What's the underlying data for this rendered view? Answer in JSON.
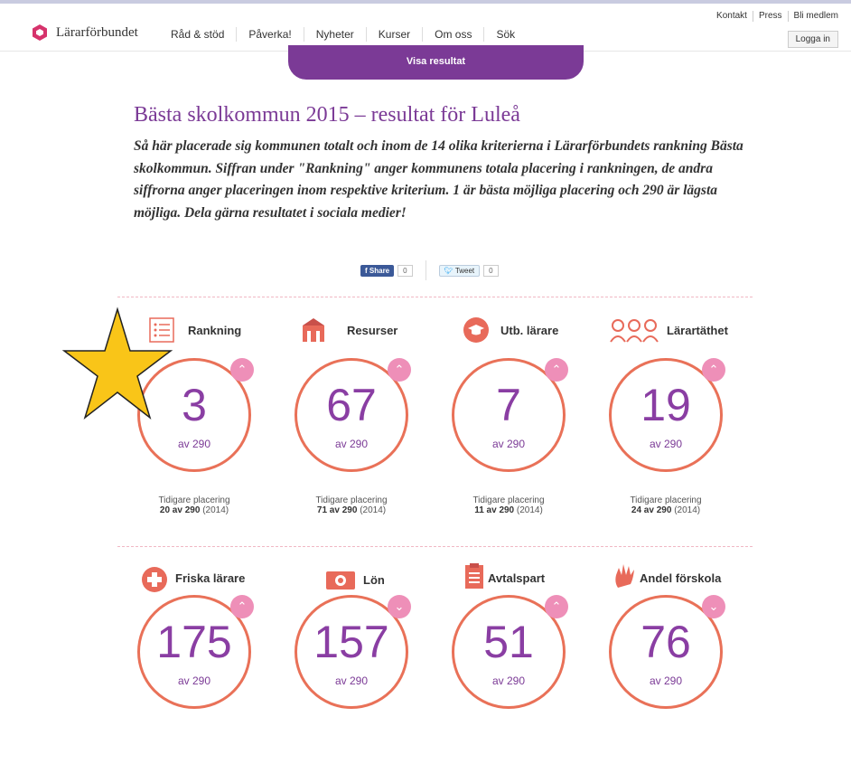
{
  "header": {
    "logo_text": "Lärarförbundet",
    "nav": [
      "Råd & stöd",
      "Påverka!",
      "Nyheter",
      "Kurser",
      "Om oss",
      "Sök"
    ],
    "util": [
      "Kontakt",
      "Press",
      "Bli medlem"
    ],
    "login": "Logga in"
  },
  "visa_resultat": "Visa resultat",
  "title": "Bästa skolkommun 2015 – resultat för Luleå",
  "intro": "Så här placerade sig kommunen totalt och inom de 14 olika kriterierna i Lärarförbundets rankning Bästa skolkommun. Siffran under \"Rankning\" anger kommunens totala placering i rankningen, de andra siffrorna anger placeringen inom respektive kriterium. 1 är bästa möjliga placering och 290 är lägsta möjliga. Dela gärna resultatet i sociala medier!",
  "social": {
    "share": "Share",
    "share_count": "0",
    "tweet": "Tweet",
    "tweet_count": "0"
  },
  "colors": {
    "purple": "#7b3a96",
    "ring": "#e97158",
    "trend": "#ee8fb8"
  },
  "criteria": [
    {
      "label": "Rankning",
      "icon": "list-icon",
      "number": "3",
      "sub": "av 290",
      "trend": "up",
      "prev_label": "Tidigare placering",
      "prev_value": "20 av 290",
      "prev_year": "(2014)"
    },
    {
      "label": "Resurser",
      "icon": "building-icon",
      "number": "67",
      "sub": "av 290",
      "trend": "up",
      "prev_label": "Tidigare placering",
      "prev_value": "71 av 290",
      "prev_year": "(2014)"
    },
    {
      "label": "Utb. lärare",
      "icon": "graduation-cap-icon",
      "number": "7",
      "sub": "av 290",
      "trend": "up",
      "prev_label": "Tidigare placering",
      "prev_value": "11 av 290",
      "prev_year": "(2014)"
    },
    {
      "label": "Lärartäthet",
      "icon": "people-icon",
      "number": "19",
      "sub": "av 290",
      "trend": "up",
      "prev_label": "Tidigare placering",
      "prev_value": "24 av 290",
      "prev_year": "(2014)"
    },
    {
      "label": "Friska lärare",
      "icon": "health-cross-icon",
      "number": "175",
      "sub": "av 290",
      "trend": "up"
    },
    {
      "label": "Lön",
      "icon": "money-icon",
      "number": "157",
      "sub": "av 290",
      "trend": "down"
    },
    {
      "label": "Avtalspart",
      "icon": "document-icon",
      "number": "51",
      "sub": "av 290",
      "trend": "up"
    },
    {
      "label": "Andel förskola",
      "icon": "hand-icon",
      "number": "76",
      "sub": "av 290",
      "trend": "down"
    }
  ]
}
